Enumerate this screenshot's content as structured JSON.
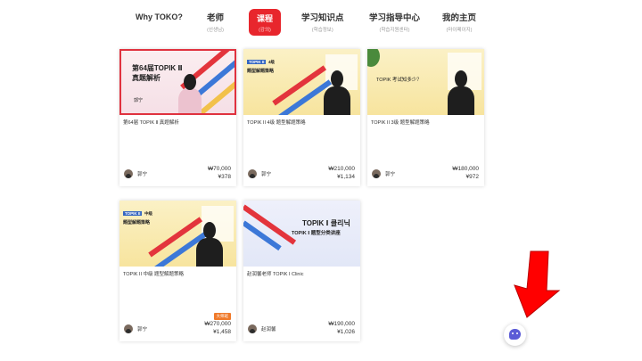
{
  "nav": {
    "why": {
      "label": "Why TOKO?"
    },
    "teacher": {
      "label": "老师",
      "sub": "(선생님)"
    },
    "courses": {
      "label": "课程",
      "sub": "(강의)"
    },
    "knowledge": {
      "label": "学习知识点",
      "sub": "(학습정보)"
    },
    "guide": {
      "label": "学习指导中心",
      "sub": "(학습지원센터)"
    },
    "home": {
      "label": "我的主页",
      "sub": "(마이페이지)"
    }
  },
  "courses": [
    {
      "title": "第64届 TOPIK Ⅱ 真题解析",
      "teacher": "郭宁",
      "price_krw": "₩70,000",
      "price_cny": "¥378",
      "thumb_lines": [
        "第64届TOPIK Ⅱ",
        "真题解析"
      ],
      "thumb_name": "郭宁",
      "selected": true
    },
    {
      "title": "TOPIK II 4级 题型解题策略",
      "teacher": "郭宁",
      "price_krw": "₩210,000",
      "price_cny": "¥1,134",
      "thumb_tag": "TOPIK II",
      "thumb_tag_suffix": "4级",
      "thumb_lines": [
        "题型解题策略"
      ]
    },
    {
      "title": "TOPIK II 3级 题型解题策略",
      "teacher": "郭宁",
      "price_krw": "₩180,000",
      "price_cny": "¥972",
      "thumb_lines": [
        "TOPIK 考试知多少？"
      ]
    },
    {
      "title": "TOPIK II 中级 题型解题策略",
      "teacher": "郭宁",
      "price_krw": "₩270,000",
      "price_cny": "¥1,458",
      "badge": "大师班",
      "thumb_tag": "TOPIK II",
      "thumb_tag_suffix": "中级",
      "thumb_lines": [
        "题型解题策略"
      ]
    },
    {
      "title": "赵润馨老师 TOPIK I Clinic",
      "teacher": "赵润馨",
      "price_krw": "₩190,000",
      "price_cny": "¥1,026",
      "thumb_lines": [
        "TOPIK Ⅰ  클리닉",
        "TOPIK Ⅰ 题型分类讲座"
      ]
    }
  ],
  "colors": {
    "accent_red": "#e8262d",
    "card_badge": "#f07a2a",
    "chat_purple": "#5b5bd6",
    "annotation_arrow": "#ff0000"
  },
  "icons": {
    "chat": "chat-bubble-icon",
    "annotation": "red-down-arrow"
  }
}
